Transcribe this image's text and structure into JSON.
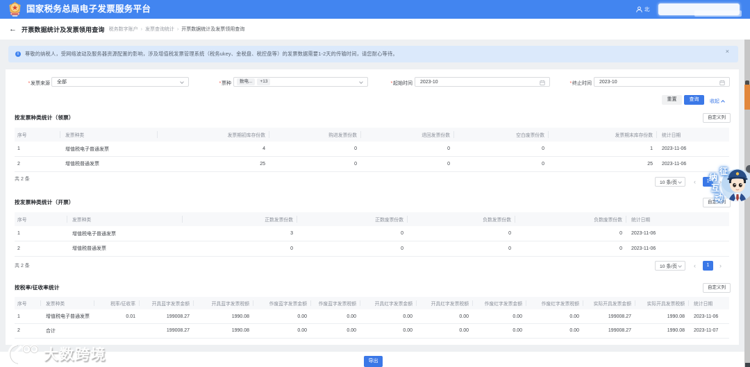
{
  "colors": {
    "brand_blue": "#4285f0",
    "button_blue": "#3b78e7",
    "notice_bg": "#dbe9fb",
    "page_bg": "#eef0f2",
    "scroll_thumb_orange": "#e2873c"
  },
  "topbar": {
    "brand": "国家税务总局电子发票服务平台",
    "user_prefix": "北"
  },
  "titlebar": {
    "back_icon": "←",
    "title": "开票数据统计及发票领用查询",
    "breadcrumb": [
      "税务数字账户",
      "发票查询统计",
      "开票数据统计及发票领用查询"
    ],
    "breadcrumb_sep": "›"
  },
  "notice": {
    "icon": "i",
    "text": "尊敬的纳税人，受网络波动及服务器资源配置的影响，涉及增值税发票管理系统（税务ukey、金税盘、税控盘等）的发票数据需要1-2天的传输时间，请您耐心等待。",
    "close_icon": "×"
  },
  "filters": {
    "source": {
      "required": "*",
      "label": "发票来源",
      "value": "全部"
    },
    "type": {
      "required": "*",
      "label": "票种",
      "tags": [
        "数电...",
        "+13"
      ]
    },
    "start": {
      "required": "*",
      "label": "起始时间",
      "value": "2023-10"
    },
    "end": {
      "required": "*",
      "label": "终止时间",
      "value": "2023-10"
    }
  },
  "actions": {
    "reset": "重置",
    "query": "查询",
    "collapse": "收起"
  },
  "sections": [
    {
      "title": "按发票种类统计（领票）",
      "customize_label": "自定义列",
      "table": {
        "headers": [
          "序号",
          "发票种类",
          "发票期初库存份数",
          "购进发票份数",
          "退回发票份数",
          "空白废票份数",
          "发票期末库存份数",
          "统计日期"
        ],
        "rows": [
          [
            "1",
            "增值税电子普通发票",
            "4",
            "0",
            "0",
            "0",
            "1",
            "2023-11-06"
          ],
          [
            "2",
            "增值税普通发票",
            "25",
            "0",
            "0",
            "0",
            "25",
            "2023-11-06"
          ]
        ]
      },
      "pagination": {
        "total": "共 2 条",
        "page_size": "10 条/页",
        "prev_icon": "‹",
        "current_page": "1",
        "next_icon": "›"
      }
    },
    {
      "title": "按发票种类统计（开票）",
      "customize_label": "自定义列",
      "table": {
        "headers": [
          "序号",
          "发票种类",
          "正数发票份数",
          "正数废票份数",
          "负数发票份数",
          "负数废票份数",
          "统计日期"
        ],
        "rows": [
          [
            "1",
            "增值税电子普通发票",
            "3",
            "0",
            "0",
            "0",
            "2023-11-06"
          ],
          [
            "2",
            "增值税普通发票",
            "0",
            "0",
            "0",
            "0",
            "2023-11-06"
          ]
        ]
      },
      "pagination": {
        "total": "共 2 条",
        "page_size": "10 条/页",
        "prev_icon": "‹",
        "current_page": "1",
        "next_icon": "›"
      }
    },
    {
      "title": "按税率/征收率统计",
      "customize_label": "自定义列",
      "table": {
        "headers": [
          "序号",
          "发票种类",
          "税率/征收率",
          "开具蓝字发票金额",
          "开具蓝字发票税额",
          "作废蓝字发票金额",
          "作废蓝字发票税额",
          "开具红字发票金额",
          "开具红字发票税额",
          "作废红字发票金额",
          "作废红字发票税额",
          "实际开具发票金额",
          "实际开具发票税额",
          "统计日期"
        ],
        "rows": [
          [
            "1",
            "增值税电子普通发票",
            "0.01",
            "199008.27",
            "1990.08",
            "0.00",
            "0.00",
            "0.00",
            "0.00",
            "0.00",
            "0.00",
            "199008.27",
            "1990.08",
            "2023-11-06"
          ],
          [
            "2",
            "合计",
            "",
            "199008.27",
            "1990.08",
            "0.00",
            "0.00",
            "0.00",
            "0.00",
            "0.00",
            "0.00",
            "199008.27",
            "1990.08",
            "2023-11-07"
          ]
        ]
      }
    }
  ],
  "footer": {
    "export_label": "导出"
  },
  "assist_widget": {
    "chars": [
      "征",
      "纳",
      "互",
      "动"
    ]
  },
  "watermark": {
    "text": "大数跨境"
  }
}
